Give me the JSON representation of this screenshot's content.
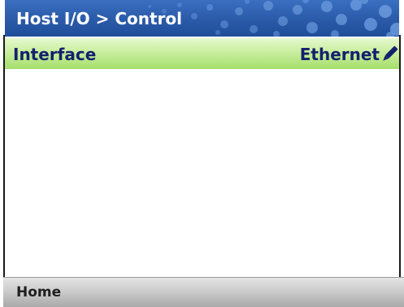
{
  "header": {
    "title": "Host I/O > Control"
  },
  "settings": [
    {
      "label": "Interface",
      "value": "Ethernet",
      "icon": "pencil-edit-icon"
    }
  ],
  "footer": {
    "home_label": "Home"
  },
  "colors": {
    "title_bar": "#2a5aa8",
    "title_text": "#ffffff",
    "row_highlight": "#c9ee9e",
    "row_text": "#14206e",
    "footer_bar": "#c9c9c9",
    "footer_text": "#1e1e1e"
  }
}
